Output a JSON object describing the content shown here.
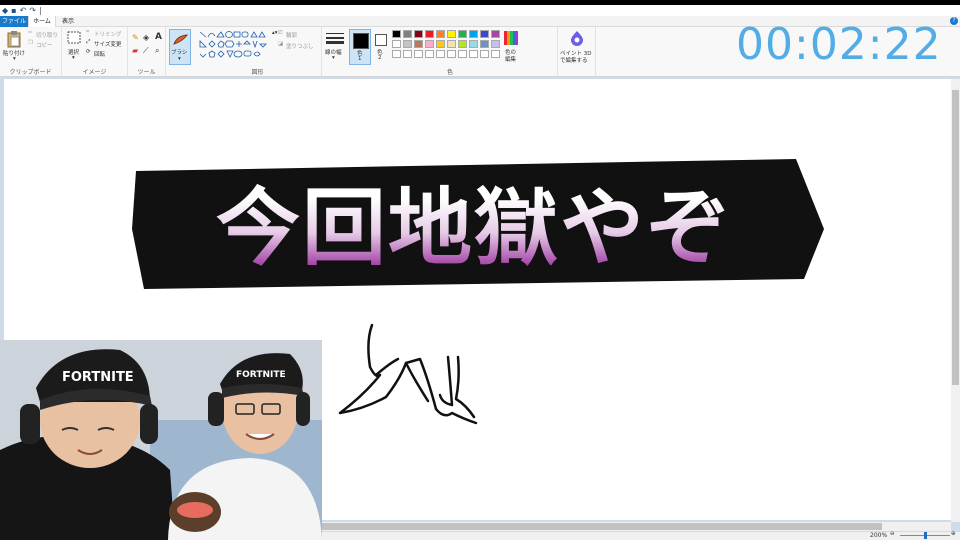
{
  "quick_access": {
    "title_sep": "|"
  },
  "tabs": [
    {
      "label": "ファイル"
    },
    {
      "label": "ホーム"
    },
    {
      "label": "表示"
    }
  ],
  "help_label": "?",
  "ribbon": {
    "clipboard": {
      "paste": "貼り付け",
      "cut": "切り取り",
      "copy": "コピー",
      "label": "クリップボード"
    },
    "image": {
      "select": "選択",
      "crop": "トリミング",
      "resize": "サイズ変更",
      "rotate": "回転",
      "label": "イメージ"
    },
    "tools": {
      "label": "ツール"
    },
    "brushes": {
      "label": "ブラシ"
    },
    "shapes": {
      "outline": "輪郭",
      "fill": "塗りつぶし",
      "label": "図形"
    },
    "size": {
      "label": "線の幅"
    },
    "color1": {
      "label": "色",
      "num": "1"
    },
    "color2": {
      "label": "色",
      "num": "2"
    },
    "colors": {
      "label": "色",
      "edit_line1": "色の",
      "edit_line2": "編集"
    },
    "paint3d": {
      "line1": "ペイント 3D",
      "line2": "で編集する"
    }
  },
  "palette": {
    "row1": [
      "#000000",
      "#7f7f7f",
      "#880015",
      "#ed1c24",
      "#ff7f27",
      "#fff200",
      "#22b14c",
      "#00a2e8",
      "#3f48cc",
      "#a349a4"
    ],
    "row2": [
      "#ffffff",
      "#c3c3c3",
      "#b97a57",
      "#ffaec9",
      "#ffc90e",
      "#efe4b0",
      "#b5e61d",
      "#99d9ea",
      "#7092be",
      "#c8bfe7"
    ],
    "row3": [
      "#ffffff",
      "#ffffff",
      "#ffffff",
      "#ffffff",
      "#ffffff",
      "#ffffff",
      "#ffffff",
      "#ffffff",
      "#ffffff",
      "#ffffff"
    ]
  },
  "colors": {
    "accent": "#1979ca",
    "timer": "#52ace6",
    "title_top": "#ffffff",
    "title_bottom": "#8a1390"
  },
  "timer": {
    "value": "00:02:22"
  },
  "canvas": {
    "title_text": "今回地獄やぞ"
  },
  "status": {
    "zoom": "200%"
  },
  "webcam": {
    "cap_text_left": "FORTNITE",
    "cap_text_right": "FORTNITE"
  }
}
